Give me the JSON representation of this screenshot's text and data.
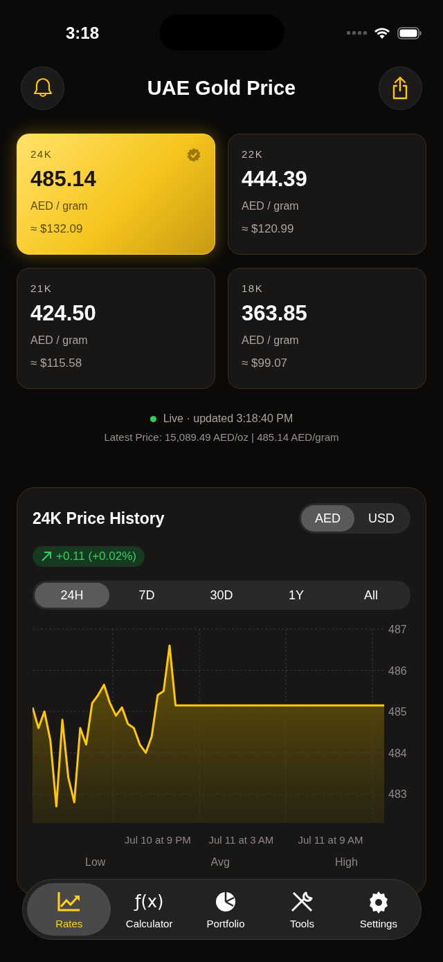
{
  "status_bar": {
    "time": "3:18"
  },
  "header": {
    "title": "UAE Gold Price"
  },
  "rates": [
    {
      "karat": "24K",
      "price": "485.14",
      "unit": "AED / gram",
      "usd": "≈ $132.09",
      "selected": true
    },
    {
      "karat": "22K",
      "price": "444.39",
      "unit": "AED / gram",
      "usd": "≈ $120.99",
      "selected": false
    },
    {
      "karat": "21K",
      "price": "424.50",
      "unit": "AED / gram",
      "usd": "≈ $115.58",
      "selected": false
    },
    {
      "karat": "18K",
      "price": "363.85",
      "unit": "AED / gram",
      "usd": "≈ $99.07",
      "selected": false
    }
  ],
  "live": {
    "on": true,
    "text": "Live · updated 3:18:40 PM",
    "latest": "Latest Price: 15,089.49 AED/oz | 485.14 AED/gram"
  },
  "history": {
    "title": "24K Price History",
    "currencies": [
      {
        "label": "AED",
        "selected": true
      },
      {
        "label": "USD",
        "selected": false
      }
    ],
    "change": "+0.11 (+0.02%)",
    "ranges": [
      {
        "label": "24H",
        "selected": true
      },
      {
        "label": "7D",
        "selected": false
      },
      {
        "label": "30D",
        "selected": false
      },
      {
        "label": "1Y",
        "selected": false
      },
      {
        "label": "All",
        "selected": false
      }
    ],
    "chart_data": {
      "type": "area",
      "grid": true,
      "categories": [
        null,
        null,
        null,
        null,
        null,
        null,
        null,
        null,
        null,
        null,
        null,
        null,
        null,
        null,
        null,
        null,
        null,
        null,
        null,
        null,
        null,
        "Jul 10 at 9 PM",
        null,
        null,
        null,
        null,
        null,
        null,
        null,
        null,
        null,
        null,
        null,
        null,
        null,
        "Jul 11 at 3 AM",
        null,
        null,
        null,
        null,
        null,
        null,
        null,
        null,
        null,
        null,
        null,
        null,
        null,
        null,
        "Jul 11 at 9 AM",
        null,
        null,
        null,
        null,
        null,
        null,
        null,
        null,
        null
      ],
      "series": [
        {
          "color": "#ffc800",
          "values": [
            485.1,
            484.6,
            485.0,
            484.3,
            482.7,
            484.8,
            483.4,
            482.8,
            484.6,
            484.2,
            485.2,
            485.4,
            485.65,
            485.2,
            484.9,
            485.1,
            484.7,
            484.6,
            484.2,
            484.0,
            484.4,
            485.4,
            485.5,
            486.6,
            485.15,
            485.15,
            485.15,
            485.15,
            485.15,
            485.15,
            485.15,
            485.15,
            485.15,
            485.15,
            485.15,
            485.15,
            485.15,
            485.15,
            485.15,
            485.15,
            485.15,
            485.15,
            485.15,
            485.15,
            485.15,
            485.15,
            485.15,
            485.15,
            485.15,
            485.15,
            485.15,
            485.15,
            485.15,
            485.15,
            485.15,
            485.15,
            485.15,
            485.15,
            485.15,
            485.15
          ]
        }
      ],
      "ylim": [
        482.3,
        487
      ],
      "yticks": [
        483,
        484,
        485,
        486,
        487
      ]
    },
    "stats": [
      {
        "label": "Low"
      },
      {
        "label": "Avg"
      },
      {
        "label": "High"
      }
    ]
  },
  "tab_bar": [
    {
      "label": "Rates",
      "kind": "chart",
      "selected": true
    },
    {
      "label": "Calculator",
      "kind": "function",
      "glyph": "ƒ(x)",
      "selected": false
    },
    {
      "label": "Portfolio",
      "kind": "pie",
      "selected": false
    },
    {
      "label": "Tools",
      "kind": "tools",
      "selected": false
    },
    {
      "label": "Settings",
      "kind": "gear",
      "selected": false
    }
  ]
}
